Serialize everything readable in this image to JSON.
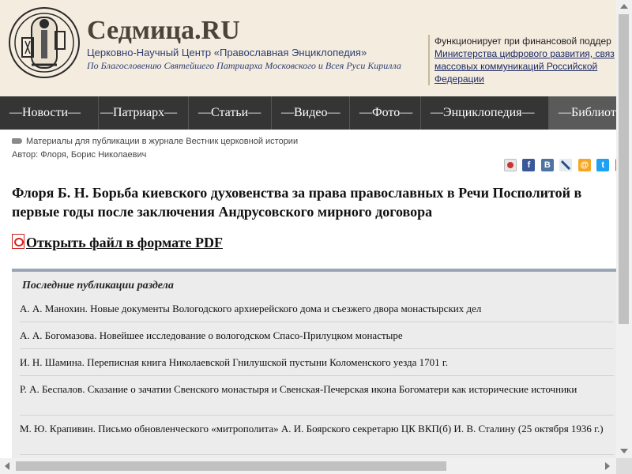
{
  "header": {
    "site_title": "Седмица.RU",
    "subtitle": "Церковно-Научный Центр «Православная Энциклопедия»",
    "blessing": "По Благословению Святейшего Патриарха Московского и Всея Руси Кирилла",
    "funding_label": "Функционирует при финансовой поддер",
    "funding_link": "Министерства цифрового развития, связ массовых коммуникаций Российской Федерации"
  },
  "nav": {
    "items": [
      {
        "label": "—Новости—"
      },
      {
        "label": "—Патриарх—"
      },
      {
        "label": "—Статьи—"
      },
      {
        "label": "—Видео—"
      },
      {
        "label": "—Фото—"
      },
      {
        "label": "—Энциклопедия—"
      },
      {
        "label": "—Библиот"
      }
    ]
  },
  "article": {
    "rubric": "Материалы для публикации в журнале Вестник церковной истории",
    "author": "Автор: Флоря, Борис Николаевич",
    "title": "Флоря Б. Н. Борьба киевского духовенства за права православных в Речи Посполитой в первые годы после заключения Андрусовского мирного договора",
    "pdf_link": "Открыть файл в формате PDF"
  },
  "share": {
    "icons": [
      "share-icon",
      "facebook-icon",
      "vkontakte-icon",
      "livejournal-icon",
      "mailru-icon",
      "twitter-icon",
      "googleplus-icon"
    ]
  },
  "recent": {
    "title": "Последние публикации раздела",
    "items": [
      {
        "text": "А. А. Манохин. Новые документы Вологодского архиерейского дома и съезжего двора монастырских дел"
      },
      {
        "text": "А. А. Богомазова. Новейшее исследование о вологодском Спасо-Прилуцком монастыре"
      },
      {
        "text": "И. Н. Шамина. Переписная книга Николаевской Гнилушской пустыни Коломенского уезда 1701 г."
      },
      {
        "text": "Р. А. Беспалов. Сказание о зачатии Свенского монастыря и Свенская-Печерская икона Богоматери как исторические источники"
      },
      {
        "text": "М. Ю. Крапивин. Письмо обновленческого «митрополита» А. И. Боярского секретарю ЦК ВКП(б) И. В. Сталину (25 октября 1936 г.)"
      }
    ]
  },
  "colors": {
    "header_bg": "#f4ecdf",
    "nav_bg": "#353535",
    "nav_active": "#5a5a5a",
    "brand_text": "#4a4438",
    "link_blue": "#2d3e73"
  }
}
